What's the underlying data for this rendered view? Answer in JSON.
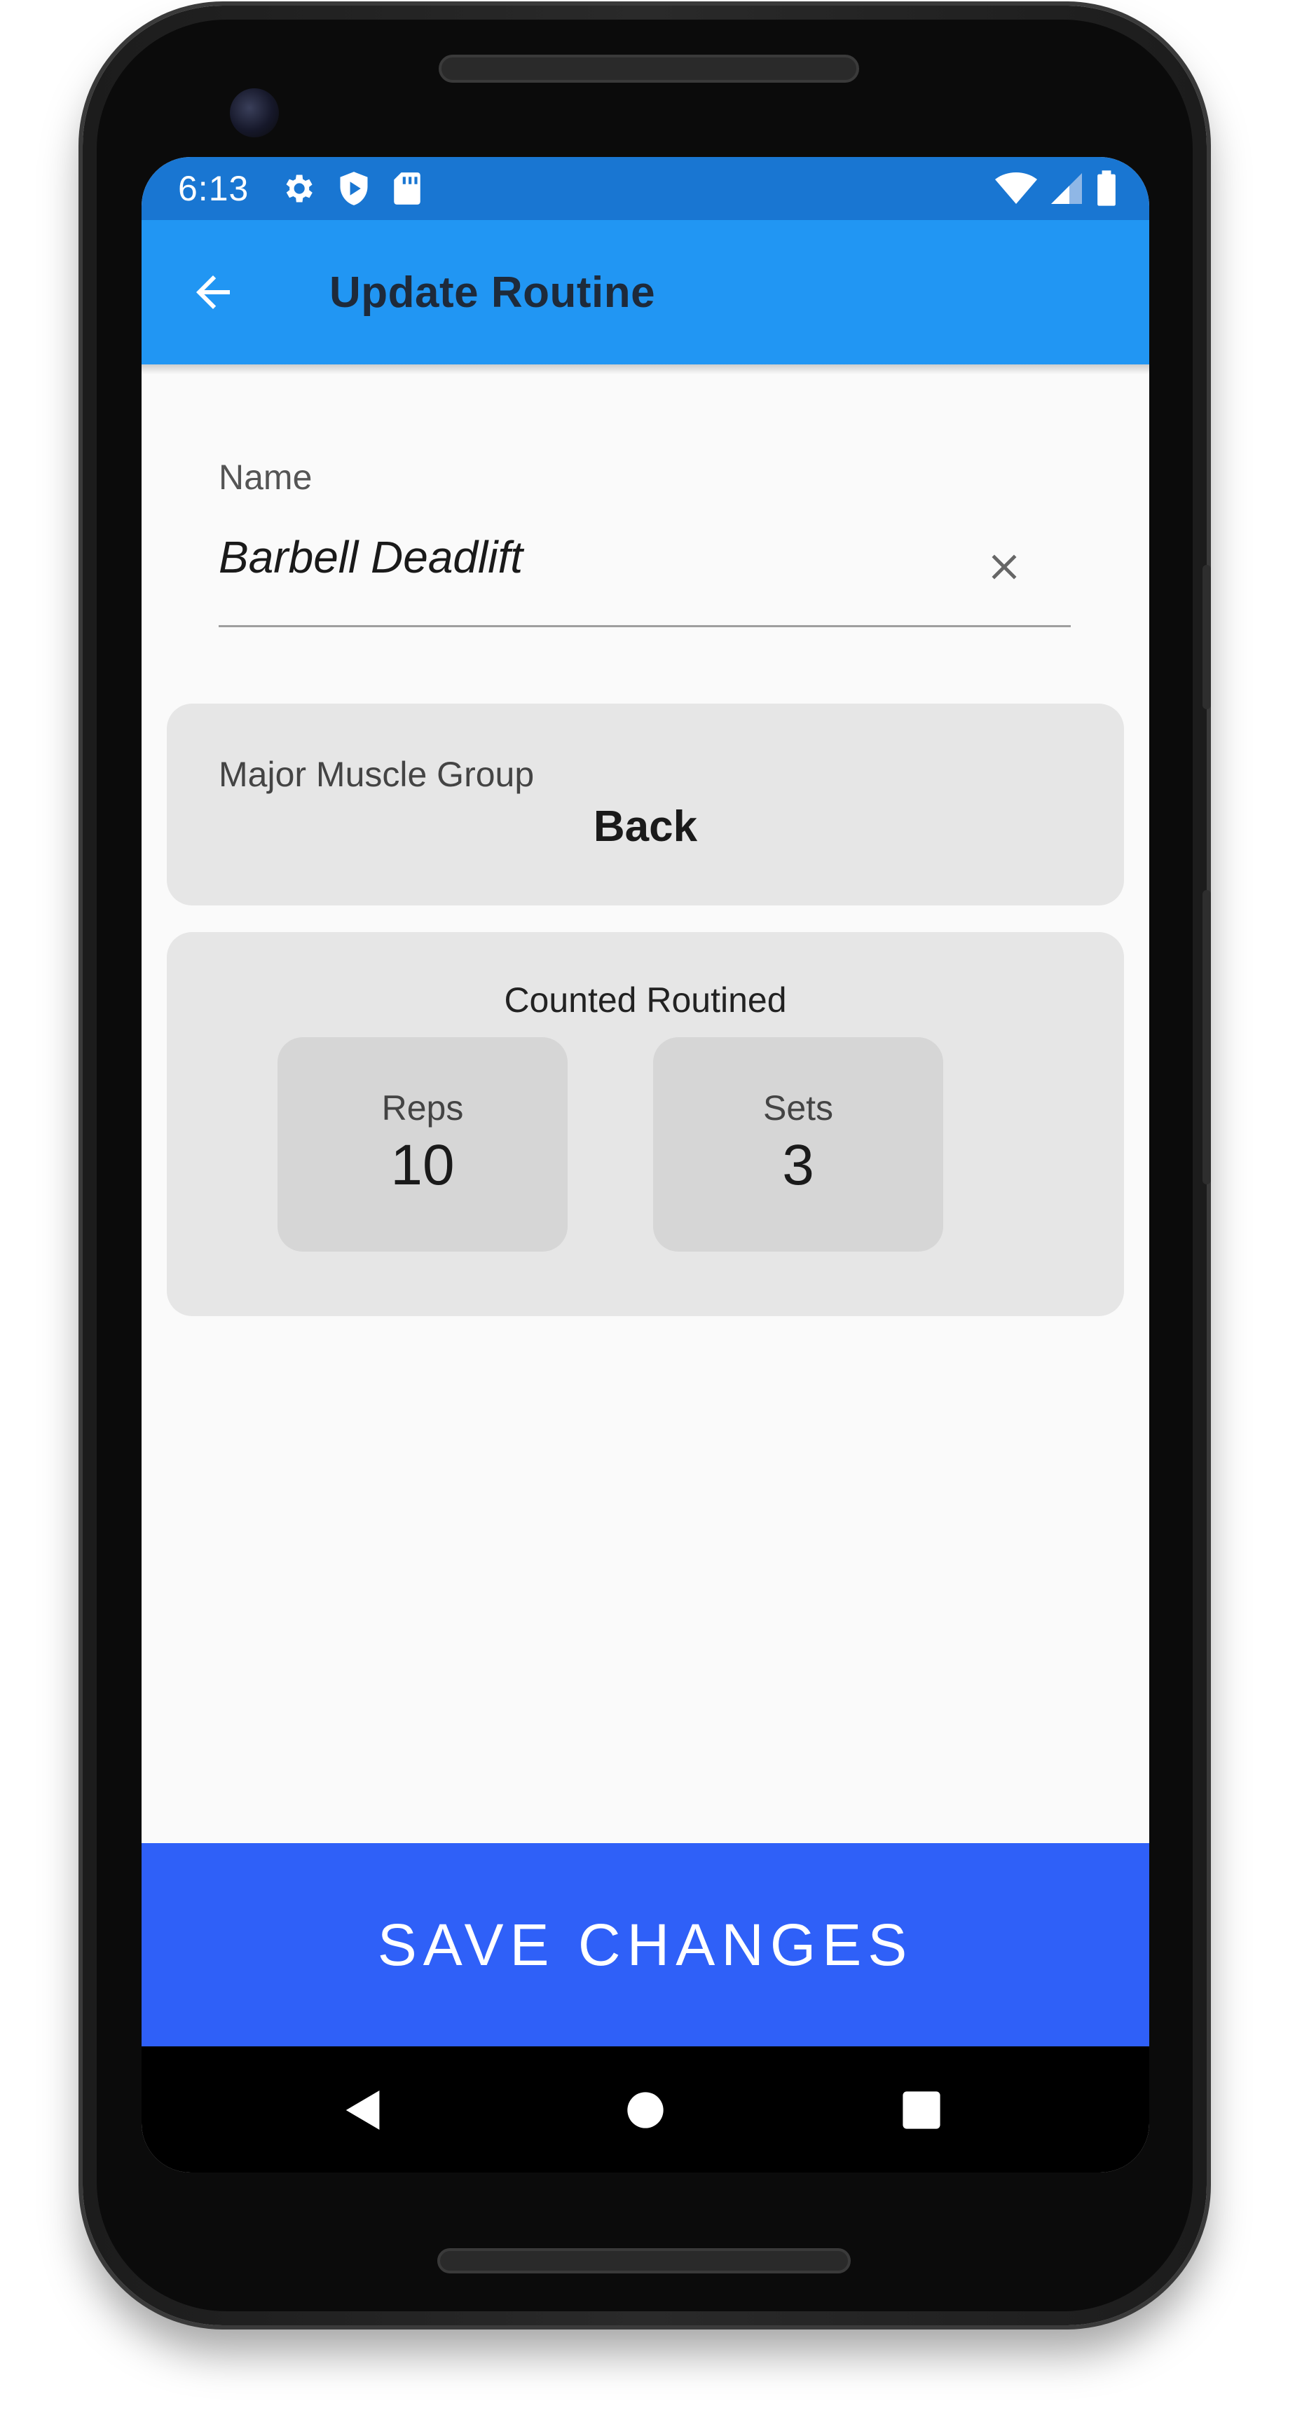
{
  "status_bar": {
    "time": "6:13",
    "icons_left": [
      "settings-icon",
      "play-protect-icon",
      "sd-card-icon"
    ],
    "icons_right": [
      "wifi-icon",
      "signal-icon",
      "battery-icon"
    ]
  },
  "app_bar": {
    "title": "Update Routine",
    "back_icon": "arrow-back-icon"
  },
  "name_field": {
    "label": "Name",
    "value": "Barbell Deadlift",
    "clear_icon": "close-icon"
  },
  "muscle_group": {
    "label": "Major Muscle Group",
    "value": "Back"
  },
  "counted_routine": {
    "title": "Counted Routined",
    "reps": {
      "label": "Reps",
      "value": "10"
    },
    "sets": {
      "label": "Sets",
      "value": "3"
    }
  },
  "save_button": {
    "label": "SAVE CHANGES"
  },
  "colors": {
    "status_bar": "#1976d2",
    "app_bar": "#2196f3",
    "save_button": "#2f60f8",
    "card": "#e6e6e6",
    "count_box": "#d6d6d6"
  }
}
